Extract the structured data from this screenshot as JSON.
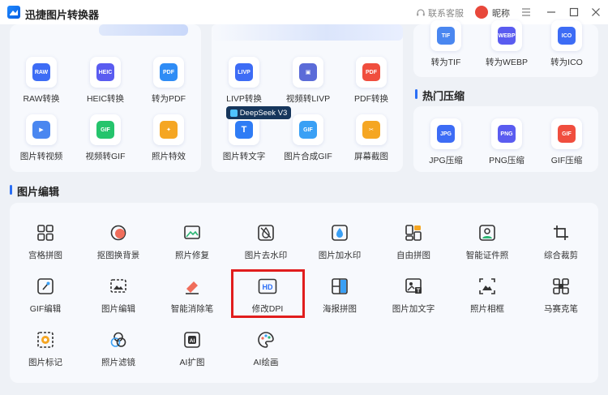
{
  "app": {
    "title": "迅捷图片转换器"
  },
  "header": {
    "support_label": "联系客服",
    "nickname": "昵称"
  },
  "convert_panel_1": {
    "items": [
      {
        "label": "RAW转换",
        "badge": "RAW",
        "color": "#3d6cf5"
      },
      {
        "label": "HEIC转换",
        "badge": "HEIC",
        "color": "#5a5cf0"
      },
      {
        "label": "转为PDF",
        "badge": "PDF",
        "color": "#2f8cf5"
      },
      {
        "label": "图片转视频",
        "badge": "",
        "color": "#4a87f0"
      },
      {
        "label": "视频转GIF",
        "badge": "GIF",
        "color": "#25c46c"
      },
      {
        "label": "照片特效",
        "badge": "",
        "color": "#f5a623"
      }
    ]
  },
  "convert_panel_2": {
    "items": [
      {
        "label": "LIVP转换",
        "badge": "LIVP",
        "color": "#3d6cf5"
      },
      {
        "label": "视频转LIVP",
        "badge": "",
        "color": "#5b6bd8"
      },
      {
        "label": "PDF转换",
        "badge": "PDF",
        "color": "#f04e3e"
      },
      {
        "label": "图片转文字",
        "badge": "T",
        "color": "#2f7cf5"
      },
      {
        "label": "图片合成GIF",
        "badge": "GIF",
        "color": "#3aa0f5"
      },
      {
        "label": "屏幕截图",
        "badge": "",
        "color": "#f5a623"
      }
    ],
    "ai_badge": "DeepSeek V3"
  },
  "convert_panel_3": {
    "items": [
      {
        "label": "转为TIF",
        "badge": "TIF",
        "color": "#4a87f0"
      },
      {
        "label": "转为WEBP",
        "badge": "WEBP",
        "color": "#5a5cf0"
      },
      {
        "label": "转为ICO",
        "badge": "ICO",
        "color": "#3d6cf5"
      }
    ]
  },
  "compress": {
    "title": "热门压缩",
    "items": [
      {
        "label": "JPG压缩",
        "badge": "JPG",
        "color": "#3d6cf5"
      },
      {
        "label": "PNG压缩",
        "badge": "PNG",
        "color": "#5a5cf0"
      },
      {
        "label": "GIF压缩",
        "badge": "GIF",
        "color": "#f04e3e"
      }
    ]
  },
  "edit": {
    "title": "图片编辑",
    "items": [
      {
        "label": "宫格拼图",
        "icon": "grid-icon"
      },
      {
        "label": "抠图换背景",
        "icon": "cutout-icon"
      },
      {
        "label": "照片修复",
        "icon": "image-repair-icon"
      },
      {
        "label": "图片去水印",
        "icon": "remove-watermark-icon"
      },
      {
        "label": "图片加水印",
        "icon": "add-watermark-icon"
      },
      {
        "label": "自由拼图",
        "icon": "free-collage-icon"
      },
      {
        "label": "智能证件照",
        "icon": "id-photo-icon"
      },
      {
        "label": "综合裁剪",
        "icon": "crop-icon"
      },
      {
        "label": "GIF编辑",
        "icon": "gif-edit-icon"
      },
      {
        "label": "图片编辑",
        "icon": "image-edit-icon"
      },
      {
        "label": "智能消除笔",
        "icon": "eraser-icon"
      },
      {
        "label": "修改DPI",
        "icon": "hd-icon",
        "badge": "HD"
      },
      {
        "label": "海报拼图",
        "icon": "poster-icon"
      },
      {
        "label": "图片加文字",
        "icon": "add-text-icon"
      },
      {
        "label": "照片相框",
        "icon": "photo-frame-icon"
      },
      {
        "label": "马赛克笔",
        "icon": "mosaic-icon"
      },
      {
        "label": "图片标记",
        "icon": "mark-icon"
      },
      {
        "label": "照片滤镜",
        "icon": "filter-icon"
      },
      {
        "label": "AI扩图",
        "icon": "ai-expand-icon",
        "badge": "AI"
      },
      {
        "label": "AI绘画",
        "icon": "ai-paint-icon"
      }
    ]
  }
}
